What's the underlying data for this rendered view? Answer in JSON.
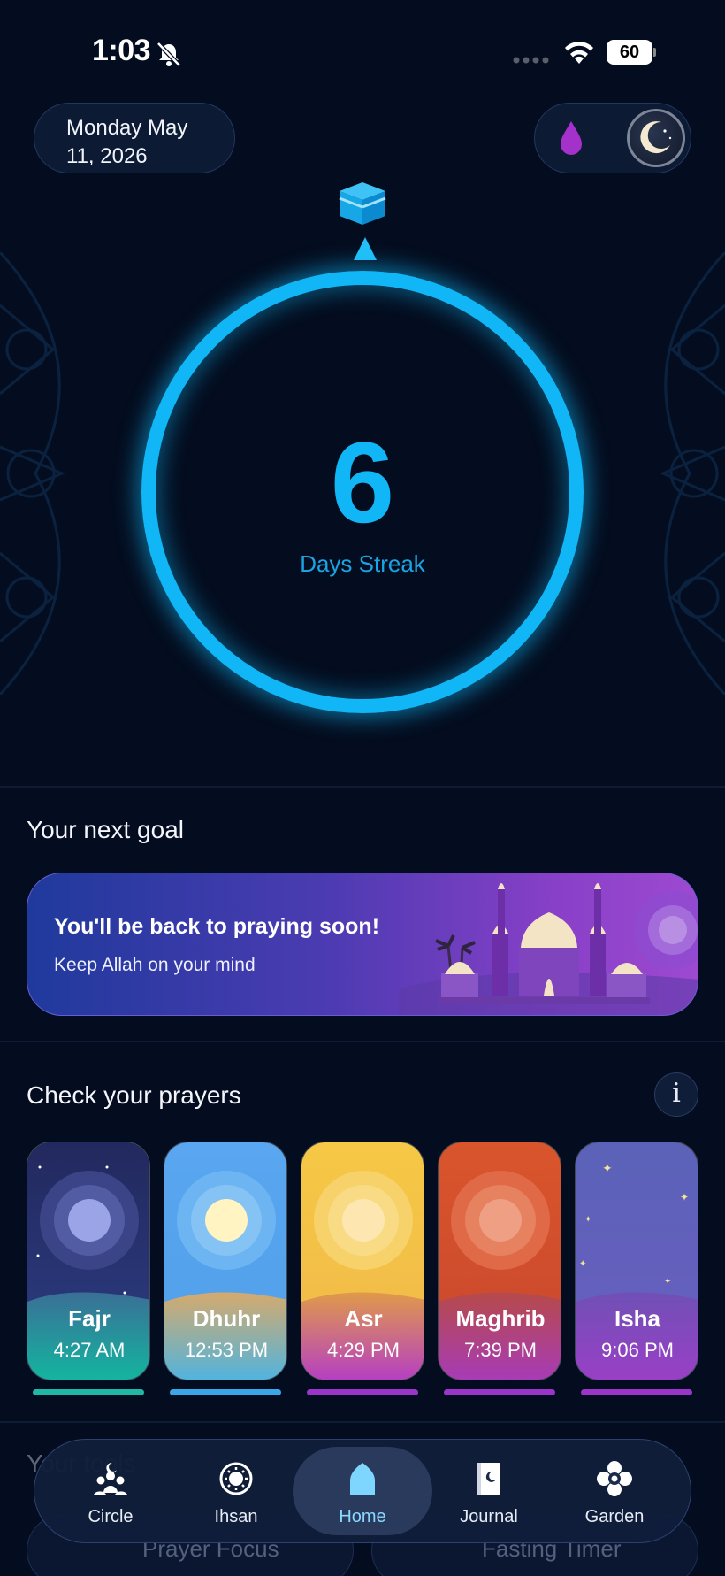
{
  "status_bar": {
    "time": "1:03",
    "battery": "60"
  },
  "header": {
    "date_line1": "Monday May",
    "date_line2": "11, 2026"
  },
  "streak": {
    "count": "6",
    "label": "Days Streak"
  },
  "next_goal": {
    "section_title": "Your next goal",
    "title": "You'll be back to praying soon!",
    "subtitle": "Keep Allah on your mind"
  },
  "prayers": {
    "section_title": "Check your prayers",
    "info_label": "i",
    "items": [
      {
        "name": "Fajr",
        "time": "4:27 AM",
        "bar_color": "#1fb8a6"
      },
      {
        "name": "Dhuhr",
        "time": "12:53 PM",
        "bar_color": "#3aa6e8"
      },
      {
        "name": "Asr",
        "time": "4:29 PM",
        "bar_color": "#9b35c9"
      },
      {
        "name": "Maghrib",
        "time": "7:39 PM",
        "bar_color": "#9b35c9"
      },
      {
        "name": "Isha",
        "time": "9:06 PM",
        "bar_color": "#9b35c9"
      }
    ]
  },
  "tools": {
    "section_title": "Your tools",
    "items": [
      "Prayer Focus",
      "Fasting Timer"
    ]
  },
  "nav": {
    "items": [
      {
        "label": "Circle",
        "icon": "people-icon"
      },
      {
        "label": "Ihsan",
        "icon": "sun-badge-icon"
      },
      {
        "label": "Home",
        "icon": "home-icon",
        "active": true
      },
      {
        "label": "Journal",
        "icon": "journal-icon"
      },
      {
        "label": "Garden",
        "icon": "flower-icon"
      }
    ]
  },
  "colors": {
    "accent": "#10b6f5",
    "background": "#040d1f"
  }
}
